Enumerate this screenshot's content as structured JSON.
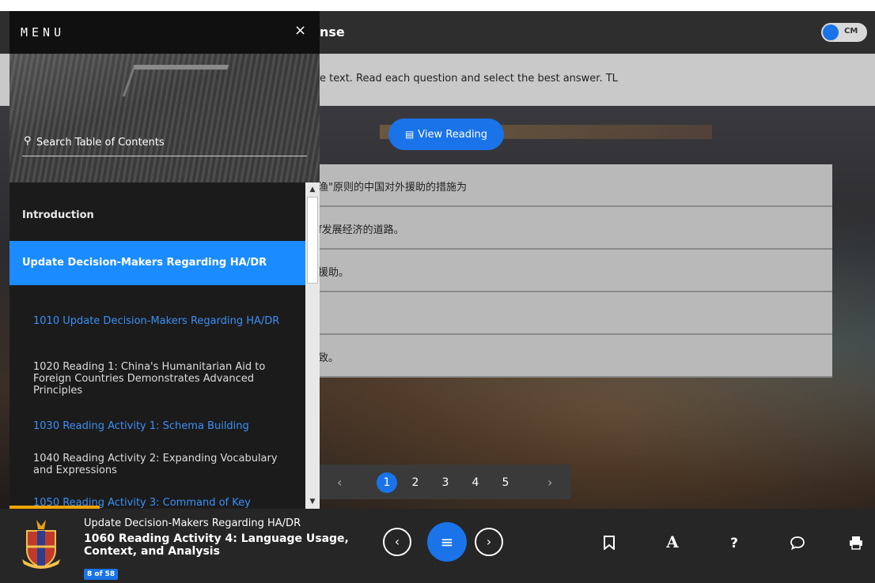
{
  "header": {
    "title": "nse",
    "cm_label": "CM"
  },
  "instruction": "e text. Read each question and select the best answer. TL",
  "view_reading": {
    "label": "View Reading"
  },
  "answers": [
    "渔\"原则的中国对外援助的措施为",
    "f发展经济的道路。",
    "援助。",
    "",
    "致。"
  ],
  "pagination": {
    "pages": [
      "1",
      "2",
      "3",
      "4",
      "5"
    ],
    "current": "1",
    "prev": "‹",
    "next": "›"
  },
  "menu": {
    "title": "MENU",
    "close": "×",
    "search_placeholder": "Search Table of Contents",
    "intro": "Introduction",
    "section": "Update Decision-Makers Regarding HA/DR",
    "items": [
      "1010 Update Decision-Makers Regarding HA/DR",
      "1020 Reading 1: China's Humanitarian Aid to Foreign Countries Demonstrates Advanced Principles",
      "1030 Reading Activity 1: Schema Building",
      "1040 Reading Activity 2: Expanding Vocabulary and Expressions",
      "1050 Reading Activity 3: Command of Key"
    ],
    "progress": 0.29
  },
  "footer": {
    "breadcrumb": "Update Decision-Makers Regarding HA/DR",
    "page_title": "1060 Reading Activity 4: Language Usage, Context, and Analysis",
    "page_badge": "8 of 58",
    "prev": "‹",
    "menu": "≡",
    "next": "›",
    "tools": {
      "bookmark": "🔖",
      "font": "A",
      "help": "?",
      "comment": "💬",
      "print": "🖶"
    }
  },
  "colors": {
    "accent": "#1a73e8",
    "menu_active": "#1a8cff",
    "link_blue": "#3b8ff5",
    "progress": "#f0a500"
  }
}
